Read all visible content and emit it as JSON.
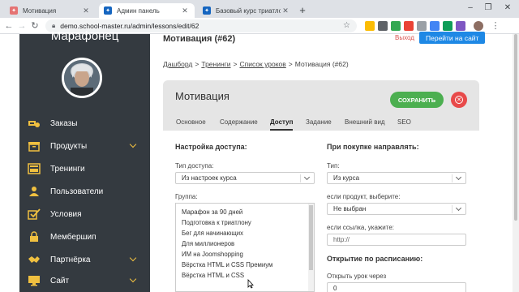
{
  "browser": {
    "tabs": [
      {
        "title": "Мотивация",
        "active": false,
        "favicon_color": "#e57373"
      },
      {
        "title": "Админ панель",
        "active": true,
        "favicon_color": "#1565c0"
      },
      {
        "title": "Базовый курс триатлониста",
        "active": false,
        "favicon_color": "#1565c0"
      }
    ],
    "new_tab": "+",
    "url": "demo.school-master.ru/admin/lessons/edit/62",
    "window_controls": [
      "–",
      "❐",
      "✕"
    ]
  },
  "sidebar": {
    "brand": "Марафонец",
    "items": [
      {
        "label": "Заказы",
        "icon": "money-icon",
        "has_submenu": false
      },
      {
        "label": "Продукты",
        "icon": "box-icon",
        "has_submenu": true
      },
      {
        "label": "Тренинги",
        "icon": "training-icon",
        "has_submenu": false
      },
      {
        "label": "Пользователи",
        "icon": "users-icon",
        "has_submenu": false
      },
      {
        "label": "Условия",
        "icon": "conditions-icon",
        "has_submenu": false
      },
      {
        "label": "Мембершип",
        "icon": "membership-icon",
        "has_submenu": false
      },
      {
        "label": "Партнёрка",
        "icon": "handshake-icon",
        "has_submenu": true
      },
      {
        "label": "Сайт",
        "icon": "site-icon",
        "has_submenu": true
      }
    ]
  },
  "header": {
    "title": "Мотивация (#62)",
    "logout": "Выход",
    "goto_site": "Перейти на сайт"
  },
  "breadcrumb": {
    "items": [
      "Дашборд",
      "Тренинги",
      "Список уроков"
    ],
    "current": "Мотивация (#62)",
    "separator": ">"
  },
  "panel": {
    "title": "Мотивация",
    "save_label": "СОХРАНИТЬ",
    "tabs": [
      "Основное",
      "Содержание",
      "Доступ",
      "Задание",
      "Внешний вид",
      "SEO"
    ],
    "active_tab": "Доступ"
  },
  "access": {
    "heading": "Настройка доступа:",
    "access_type_label": "Тип доступа:",
    "access_type_value": "Из настроек курса",
    "group_label": "Группа:",
    "groups": [
      "Марафон за 90 дней",
      "Подготовка к триатлону",
      "Бег для начинающих",
      "Для миллионеров",
      "ИМ на Joomshopping",
      "Вёрстка HTML и CSS Премиум",
      "Вёрстка HTML и CSS"
    ]
  },
  "redirect": {
    "heading": "При покупке направлять:",
    "type_label": "Тип:",
    "type_value": "Из курса",
    "product_label": "если продукт, выберите:",
    "product_value": "Не выбран",
    "link_label": "если ссылка, укажите:",
    "link_placeholder": "http://"
  },
  "schedule": {
    "heading": "Открытие по расписанию:",
    "open_after_label": "Открыть урок через",
    "open_after_value": "0"
  },
  "colors": {
    "sidebar_bg": "#343a40",
    "accent_blue": "#1e88e5",
    "save_green": "#4caf50",
    "close_red": "#e84a4a",
    "icon_gold": "#f0c040"
  }
}
